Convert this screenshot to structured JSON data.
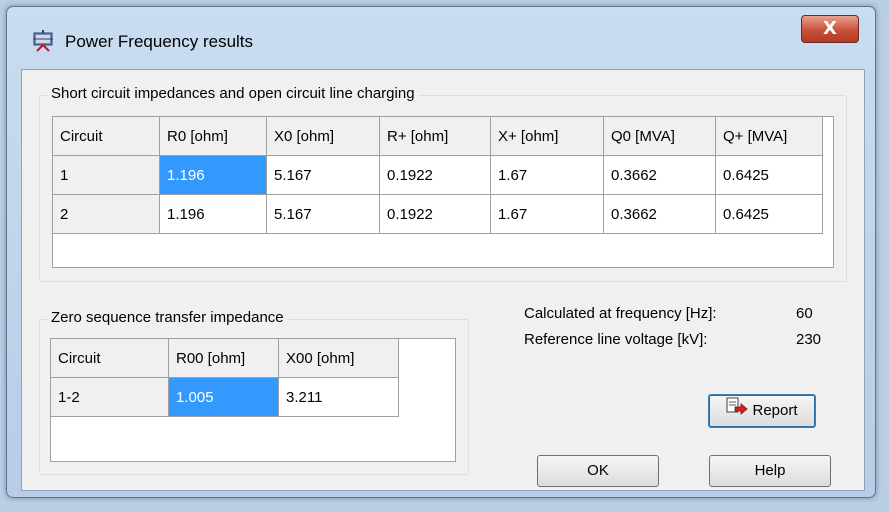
{
  "window": {
    "title": "Power Frequency results",
    "close_label": "X"
  },
  "impedances": {
    "legend": "Short circuit impedances and open circuit line charging",
    "headers": [
      "Circuit",
      "R0 [ohm]",
      "X0 [ohm]",
      "R+ [ohm]",
      "X+ [ohm]",
      "Q0 [MVA]",
      "Q+ [MVA]"
    ],
    "rows": [
      [
        "1",
        "1.196",
        "5.167",
        "0.1922",
        "1.67",
        "0.3662",
        "0.6425"
      ],
      [
        "2",
        "1.196",
        "5.167",
        "0.1922",
        "1.67",
        "0.3662",
        "0.6425"
      ]
    ]
  },
  "zero_seq": {
    "legend": "Zero sequence transfer impedance",
    "headers": [
      "Circuit",
      "R00 [ohm]",
      "X00 [ohm]"
    ],
    "rows": [
      [
        "1-2",
        "1.005",
        "3.211"
      ]
    ]
  },
  "info": {
    "frequency_label": "Calculated at frequency [Hz]:",
    "frequency_value": "60",
    "voltage_label": "Reference line voltage [kV]:",
    "voltage_value": "230"
  },
  "buttons": {
    "report": "Report",
    "ok": "OK",
    "help": "Help"
  },
  "icons": {
    "app": "power-line-app-icon",
    "report": "report-arrow-icon"
  },
  "colors": {
    "selection": "#3399ff",
    "title_bar": "#c9dcf0",
    "close": "#c8503a"
  }
}
